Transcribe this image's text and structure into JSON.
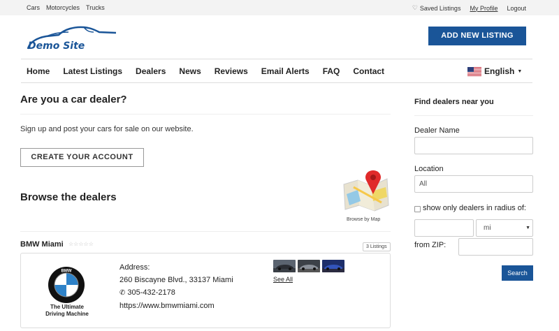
{
  "topbar": {
    "links": [
      "Cars",
      "Motorcycles",
      "Trucks"
    ],
    "saved_listings": "Saved Listings",
    "my_profile": "My Profile",
    "logout": "Logout"
  },
  "logo": {
    "text": "Demo Site"
  },
  "header": {
    "add_listing_button": "ADD NEW LISTING"
  },
  "nav": {
    "items": [
      "Home",
      "Latest Listings",
      "Dealers",
      "News",
      "Reviews",
      "Email Alerts",
      "FAQ",
      "Contact"
    ],
    "language": "English"
  },
  "main": {
    "dealer_heading": "Are you a car dealer?",
    "signup_text": "Sign up and post your cars for sale on our website.",
    "create_account_button": "CREATE YOUR ACCOUNT",
    "browse_heading": "Browse the dealers",
    "browse_by_map": "Browse by Map"
  },
  "dealer": {
    "name": "BMW Miami",
    "stars": "☆☆☆☆☆",
    "listings_badge": "3 Listings",
    "tagline_line1": "The Ultimate",
    "tagline_line2": "Driving Machine",
    "address_label": "Address:",
    "address": "260 Biscayne Blvd., 33137 Miami",
    "phone": "305-432-2178",
    "website": "https://www.bmwmiami.com",
    "see_all": "See All",
    "logo_letters": "BMW"
  },
  "sidebar": {
    "heading": "Find dealers near you",
    "dealer_name_label": "Dealer Name",
    "dealer_name_value": "",
    "location_label": "Location",
    "location_value": "All",
    "radius_label": "show only dealers in radius of:",
    "radius_value": "",
    "unit_value": "mi",
    "from_zip_label": "from ZIP:",
    "zip_value": "",
    "search_button": "Search"
  },
  "colors": {
    "brand_blue": "#1a5598"
  }
}
